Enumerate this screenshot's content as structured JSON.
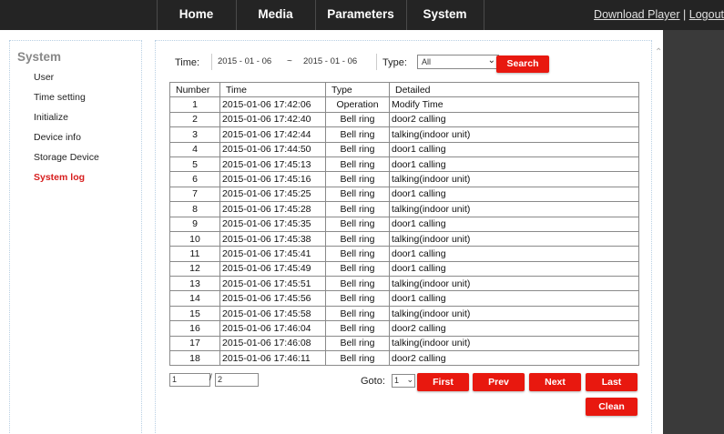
{
  "nav": {
    "items": [
      {
        "label": "Home"
      },
      {
        "label": "Media"
      },
      {
        "label": "Parameters"
      },
      {
        "label": "System"
      }
    ],
    "download_label": "Download Player",
    "separator": "|",
    "logout_label": "Logout"
  },
  "sidebar": {
    "title": "System",
    "items": [
      {
        "label": "User"
      },
      {
        "label": "Time setting"
      },
      {
        "label": "Initialize"
      },
      {
        "label": "Device info"
      },
      {
        "label": "Storage Device"
      },
      {
        "label": "System log"
      }
    ],
    "active_item": "System log"
  },
  "filter": {
    "time_label": "Time:",
    "start_date": "2015 - 01 - 06",
    "range_separator": "~",
    "end_date": "2015 - 01 - 06",
    "type_label": "Type:",
    "type_value": "All",
    "search_label": "Search"
  },
  "table": {
    "headers": [
      "Number",
      "Time",
      "Type",
      "Detailed"
    ],
    "rows": [
      [
        "1",
        "2015-01-06 17:42:06",
        "Operation",
        "Modify Time"
      ],
      [
        "2",
        "2015-01-06 17:42:40",
        "Bell ring",
        "door2 calling"
      ],
      [
        "3",
        "2015-01-06 17:42:44",
        "Bell ring",
        "talking(indoor unit)"
      ],
      [
        "4",
        "2015-01-06 17:44:50",
        "Bell ring",
        "door1 calling"
      ],
      [
        "5",
        "2015-01-06 17:45:13",
        "Bell ring",
        "door1 calling"
      ],
      [
        "6",
        "2015-01-06 17:45:16",
        "Bell ring",
        "talking(indoor unit)"
      ],
      [
        "7",
        "2015-01-06 17:45:25",
        "Bell ring",
        "door1 calling"
      ],
      [
        "8",
        "2015-01-06 17:45:28",
        "Bell ring",
        "talking(indoor unit)"
      ],
      [
        "9",
        "2015-01-06 17:45:35",
        "Bell ring",
        "door1 calling"
      ],
      [
        "10",
        "2015-01-06 17:45:38",
        "Bell ring",
        "talking(indoor unit)"
      ],
      [
        "11",
        "2015-01-06 17:45:41",
        "Bell ring",
        "door1 calling"
      ],
      [
        "12",
        "2015-01-06 17:45:49",
        "Bell ring",
        "door1 calling"
      ],
      [
        "13",
        "2015-01-06 17:45:51",
        "Bell ring",
        "talking(indoor unit)"
      ],
      [
        "14",
        "2015-01-06 17:45:56",
        "Bell ring",
        "door1 calling"
      ],
      [
        "15",
        "2015-01-06 17:45:58",
        "Bell ring",
        "talking(indoor unit)"
      ],
      [
        "16",
        "2015-01-06 17:46:04",
        "Bell ring",
        "door2 calling"
      ],
      [
        "17",
        "2015-01-06 17:46:08",
        "Bell ring",
        "talking(indoor unit)"
      ],
      [
        "18",
        "2015-01-06 17:46:11",
        "Bell ring",
        "door2 calling"
      ]
    ]
  },
  "pagination": {
    "current_page": "1",
    "separator": "/",
    "total_pages": "2",
    "goto_label": "Goto:",
    "goto_value": "1",
    "first_label": "First",
    "prev_label": "Prev",
    "next_label": "Next",
    "last_label": "Last",
    "clean_label": "Clean"
  },
  "icons": {
    "dropdown": "chevron-down-icon",
    "scroll": "scroll-up-icon"
  },
  "colors": {
    "accent": "#e8180f",
    "topbar": "#242424",
    "active_sidebar": "#d71d1d",
    "right_pane": "#3a3a3a"
  }
}
